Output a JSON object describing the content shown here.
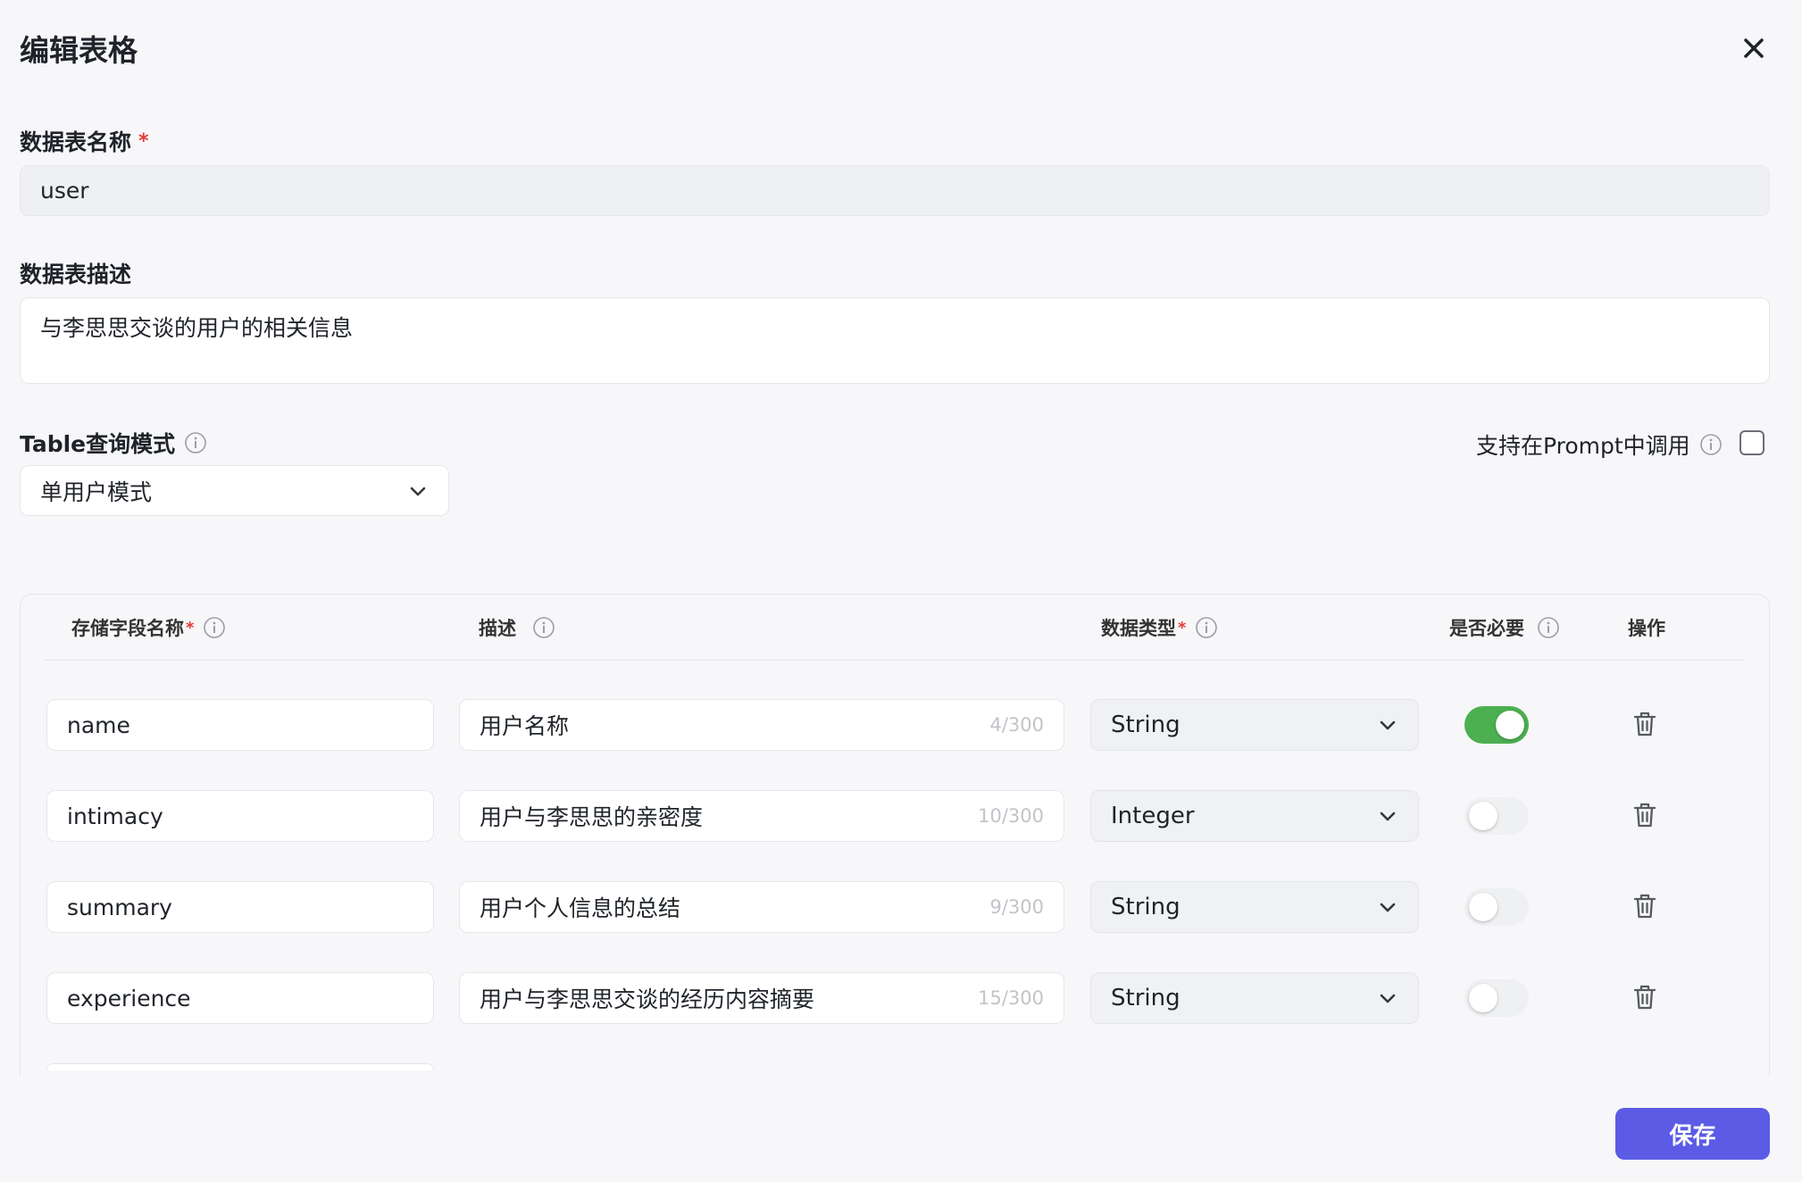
{
  "dialog": {
    "title": "编辑表格"
  },
  "table_name": {
    "label": "数据表名称",
    "required_mark": "*",
    "value": "user"
  },
  "table_desc": {
    "label": "数据表描述",
    "value": "与李思思交谈的用户的相关信息"
  },
  "query_mode": {
    "label": "Table查询模式",
    "value": "单用户模式"
  },
  "prompt_support": {
    "label": "支持在Prompt中调用",
    "checked": false
  },
  "fields_table": {
    "headers": {
      "name": "存储字段名称",
      "desc": "描述",
      "type": "数据类型",
      "required": "是否必要",
      "action": "操作",
      "required_mark": "*"
    },
    "rows": [
      {
        "name": "name",
        "desc": "用户名称",
        "count": "4/300",
        "type": "String",
        "required": true
      },
      {
        "name": "intimacy",
        "desc": "用户与李思思的亲密度",
        "count": "10/300",
        "type": "Integer",
        "required": false
      },
      {
        "name": "summary",
        "desc": "用户个人信息的总结",
        "count": "9/300",
        "type": "String",
        "required": false
      },
      {
        "name": "experience",
        "desc": "用户与李思思交谈的经历内容摘要",
        "count": "15/300",
        "type": "String",
        "required": false
      }
    ]
  },
  "footer": {
    "save_label": "保存"
  },
  "colors": {
    "accent": "#5b5be6",
    "toggle_on": "#4caf50",
    "required": "#e53935"
  }
}
